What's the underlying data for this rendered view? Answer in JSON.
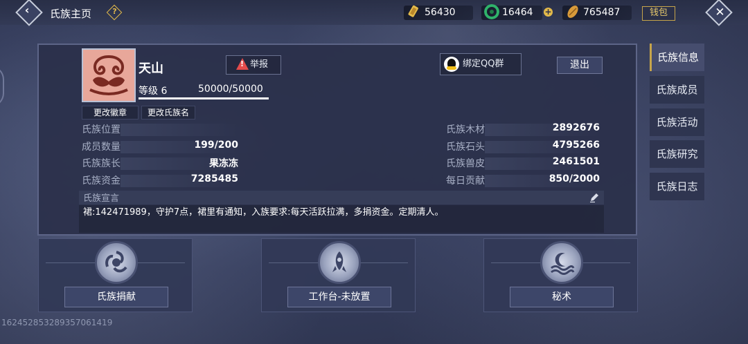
{
  "topbar": {
    "back_icon": "chevron-left-icon",
    "title": "氏族主页",
    "help_icon": "question-icon",
    "currencies": [
      {
        "name": "gold-scroll",
        "value": "56430",
        "color": "#e2b94a"
      },
      {
        "name": "jade",
        "value": "16464",
        "color": "#2fb36a"
      },
      {
        "name": "coupon",
        "value": "765487",
        "color": "#d89a3a"
      }
    ],
    "plus_label": "+",
    "wallet_label": "钱包",
    "close_icon": "close-icon"
  },
  "clan": {
    "name": "天山",
    "report_label": "举报",
    "qq_label": "绑定QQ群",
    "exit_label": "退出",
    "level_label": "等级 6",
    "exp": "50000/50000",
    "change_emblem_label": "更改徽章",
    "change_name_label": "更改氏族名",
    "left_stats": [
      {
        "label": "氏族位置",
        "value": ""
      },
      {
        "label": "成员数量",
        "value": "199/200"
      },
      {
        "label": "氏族族长",
        "value": "果冻冻"
      },
      {
        "label": "氏族资金",
        "value": "7285485"
      }
    ],
    "right_stats": [
      {
        "label": "氏族木材",
        "value": "2892676"
      },
      {
        "label": "氏族石头",
        "value": "4795266"
      },
      {
        "label": "氏族兽皮",
        "value": "2461501"
      },
      {
        "label": "每日贡献",
        "value": "850/2000"
      }
    ],
    "declaration_label": "氏族宣言",
    "declaration_text": "裙:142471989，守护7点，裙里有通知，入族要求:每天活跃拉满，多捐资金。定期清人。"
  },
  "cards": [
    {
      "label": "氏族捐献",
      "icon": "swirl-icon"
    },
    {
      "label": "工作台-未放置",
      "icon": "rocket-icon"
    },
    {
      "label": "秘术",
      "icon": "moon-wave-icon"
    }
  ],
  "tabs": [
    {
      "label": "氏族信息",
      "active": true
    },
    {
      "label": "氏族成员",
      "active": false
    },
    {
      "label": "氏族活动",
      "active": false
    },
    {
      "label": "氏族研究",
      "active": false
    },
    {
      "label": "氏族日志",
      "active": false
    }
  ],
  "uid": "1624528532893570614​19"
}
